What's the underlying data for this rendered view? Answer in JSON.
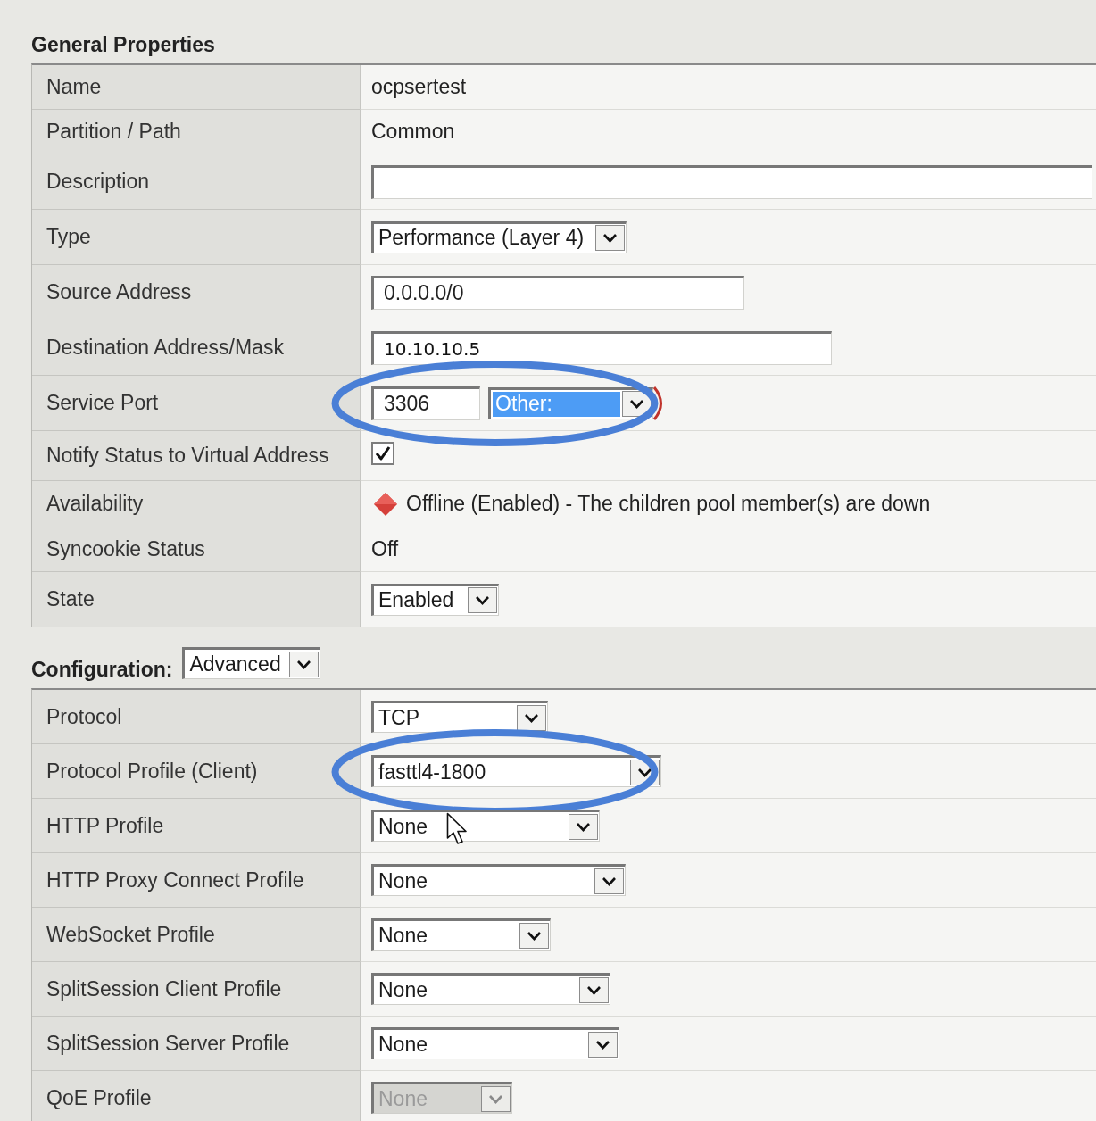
{
  "sections": [
    {
      "title": "General Properties",
      "rows": [
        {
          "label": "Name",
          "kind": "text",
          "value": "ocpsertest"
        },
        {
          "label": "Partition / Path",
          "kind": "text",
          "value": "Common"
        },
        {
          "label": "Description",
          "kind": "input"
        },
        {
          "label": "Type",
          "kind": "select",
          "value": "Performance (Layer 4)",
          "disabled": false
        },
        {
          "label": "Source Address",
          "kind": "input",
          "value": "0.0.0.0/0"
        },
        {
          "label": "Destination Address/Mask",
          "kind": "input",
          "value": "10.10.10.5"
        },
        {
          "label": "Service Port",
          "kind": "port",
          "port": {
            "value": "3306"
          },
          "service": {
            "value": "Other:",
            "focused": true
          },
          "arc_mark": true,
          "circled": true
        },
        {
          "label": "Notify Status to Virtual Address",
          "kind": "checkbox",
          "checked": true
        },
        {
          "label": "Availability",
          "kind": "status",
          "value": "Offline (Enabled) - The children pool member(s) are down"
        },
        {
          "label": "Syncookie Status",
          "kind": "text",
          "value": "Off"
        },
        {
          "label": "State",
          "kind": "select",
          "value": "Enabled",
          "disabled": false
        }
      ]
    },
    {
      "title": "Configuration:",
      "select": {
        "value": "Advanced"
      },
      "rows": [
        {
          "label": "Protocol",
          "kind": "select",
          "value": "TCP",
          "disabled": false
        },
        {
          "label": "Protocol Profile (Client)",
          "kind": "select",
          "value": "fasttl4-1800",
          "disabled": false,
          "circled": true
        },
        {
          "label": "HTTP Profile",
          "kind": "select",
          "value": "None",
          "disabled": false,
          "pointer_over": true
        },
        {
          "label": "HTTP Proxy Connect Profile",
          "kind": "select",
          "value": "None",
          "disabled": false
        },
        {
          "label": "WebSocket Profile",
          "kind": "select",
          "value": "None",
          "disabled": false
        },
        {
          "label": "SplitSession Client Profile",
          "kind": "select",
          "value": "None",
          "disabled": false
        },
        {
          "label": "SplitSession Server Profile",
          "kind": "select",
          "value": "None",
          "disabled": false
        },
        {
          "label": "QoE Profile",
          "kind": "select",
          "value": "None",
          "disabled": true
        }
      ]
    }
  ]
}
